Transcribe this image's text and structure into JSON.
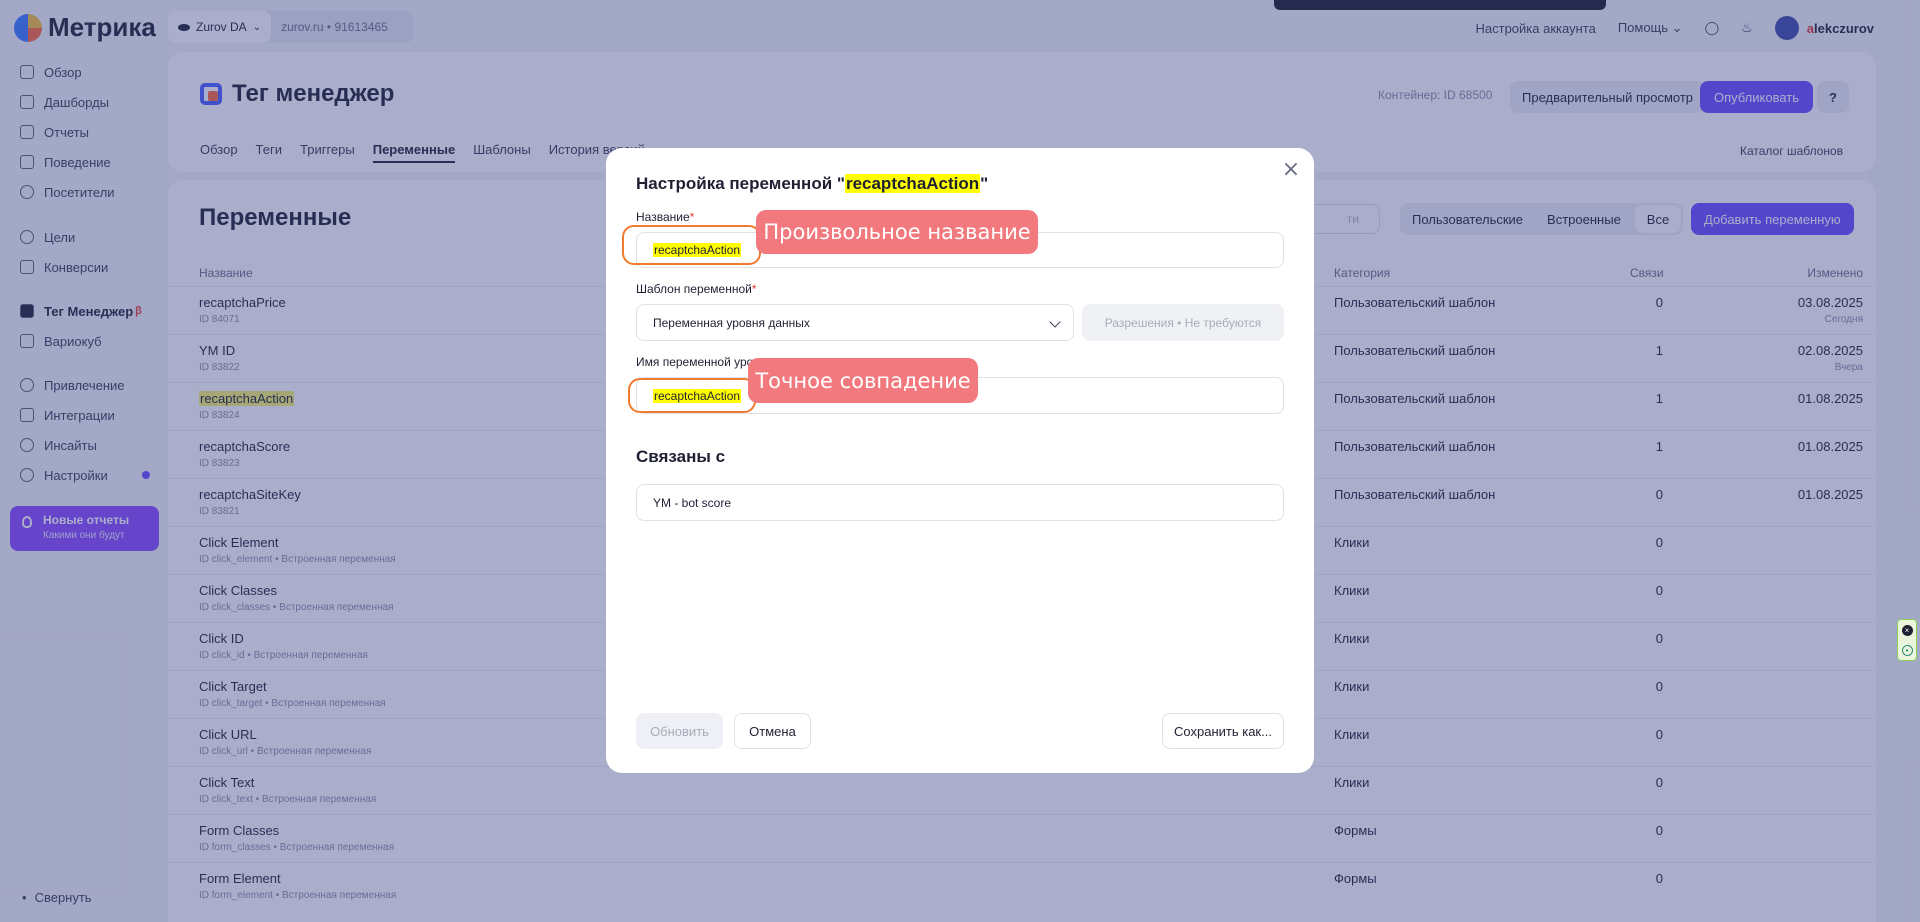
{
  "sidebar": {
    "logo": "Метрика",
    "items": [
      {
        "label": "Обзор",
        "icon": "grid-icon"
      },
      {
        "label": "Дашборды",
        "icon": "dashboard-icon"
      },
      {
        "label": "Отчеты",
        "icon": "bar-chart-icon"
      },
      {
        "label": "Поведение",
        "icon": "play-icon"
      },
      {
        "label": "Посетители",
        "icon": "user-icon"
      },
      {
        "label": "Цели",
        "icon": "target-icon"
      },
      {
        "label": "Конверсии",
        "icon": "percent-icon"
      },
      {
        "label": "Тег Менеджер",
        "icon": "tag-manager-icon",
        "badge": "β",
        "active": true
      },
      {
        "label": "Вариокуб",
        "icon": "cube-icon"
      },
      {
        "label": "Привлечение",
        "icon": "fire-icon"
      },
      {
        "label": "Интеграции",
        "icon": "plug-icon"
      },
      {
        "label": "Инсайты",
        "icon": "sparkle-icon"
      },
      {
        "label": "Настройки",
        "icon": "gear-icon"
      }
    ],
    "promo": {
      "title": "Новые отчеты",
      "subtitle": "Какими они будут"
    },
    "collapse": "Свернуть"
  },
  "topbar": {
    "counter_name": "Zurov DA",
    "counter_site": "zurov.ru",
    "counter_sep": "•",
    "counter_id": "91613465",
    "account_settings": "Настройка аккаунта",
    "help": "Помощь",
    "username_first": "a",
    "username_rest": "lekczurov"
  },
  "header": {
    "title": "Тег менеджер",
    "container_id": "Контейнер: ID 68500",
    "preview": "Предварительный просмотр",
    "publish": "Опубликовать",
    "help_icon": "?",
    "tabs": [
      "Обзор",
      "Теги",
      "Триггеры",
      "Переменные",
      "Шаблоны",
      "История версий"
    ],
    "active_tab": "Переменные",
    "catalog": "Каталог шаблонов"
  },
  "variables": {
    "title": "Переменные",
    "search_placeholder": "ти",
    "filters": [
      "Пользовательские",
      "Встроенные",
      "Все"
    ],
    "selected_filter": "Все",
    "add_button": "Добавить переменную",
    "columns": {
      "name": "Название",
      "category": "Категория",
      "links": "Связи",
      "changed": "Изменено"
    },
    "rows": [
      {
        "name": "recaptchaPrice",
        "id": "ID 84071",
        "category": "Пользовательский шаблон",
        "links": "0",
        "date": "03.08.2025",
        "date_note": "Сегодня"
      },
      {
        "name": "YM ID",
        "id": "ID 83822",
        "category": "Пользовательский шаблон",
        "links": "1",
        "date": "02.08.2025",
        "date_note": "Вчера"
      },
      {
        "name": "recaptchaAction",
        "id": "ID 83824",
        "category": "Пользовательский шаблон",
        "links": "1",
        "date": "01.08.2025",
        "date_note": "",
        "highlight": true
      },
      {
        "name": "recaptchaScore",
        "id": "ID 83823",
        "category": "Пользовательский шаблон",
        "links": "1",
        "date": "01.08.2025",
        "date_note": ""
      },
      {
        "name": "recaptchaSiteKey",
        "id": "ID 83821",
        "category": "Пользовательский шаблон",
        "links": "0",
        "date": "01.08.2025",
        "date_note": ""
      },
      {
        "name": "Click Element",
        "id": "ID click_element • Встроенная переменная",
        "category": "Клики",
        "links": "0",
        "date": "",
        "date_note": ""
      },
      {
        "name": "Click Classes",
        "id": "ID click_classes • Встроенная переменная",
        "category": "Клики",
        "links": "0",
        "date": "",
        "date_note": ""
      },
      {
        "name": "Click ID",
        "id": "ID click_id • Встроенная переменная",
        "category": "Клики",
        "links": "0",
        "date": "",
        "date_note": ""
      },
      {
        "name": "Click Target",
        "id": "ID click_target • Встроенная переменная",
        "category": "Клики",
        "links": "0",
        "date": "",
        "date_note": ""
      },
      {
        "name": "Click URL",
        "id": "ID click_url • Встроенная переменная",
        "category": "Клики",
        "links": "0",
        "date": "",
        "date_note": ""
      },
      {
        "name": "Click Text",
        "id": "ID click_text • Встроенная переменная",
        "category": "Клики",
        "links": "0",
        "date": "",
        "date_note": ""
      },
      {
        "name": "Form Classes",
        "id": "ID form_classes • Встроенная переменная",
        "category": "Формы",
        "links": "0",
        "date": "",
        "date_note": ""
      },
      {
        "name": "Form Element",
        "id": "ID form_element • Встроенная переменная",
        "category": "Формы",
        "links": "0",
        "date": "",
        "date_note": ""
      }
    ]
  },
  "modal": {
    "title_prefix": "Настройка переменной \"",
    "title_var": "recaptchaAction",
    "title_suffix": "\"",
    "name_label": "Название",
    "required_mark": "*",
    "name_value": "recaptchaAction",
    "template_label": "Шаблон переменной",
    "template_value": "Переменная уровня данных",
    "permissions": "Разрешения • Не требуются",
    "var_name_label": "Имя переменной уро",
    "var_name_value": "recaptchaAction",
    "linked_title": "Связаны с",
    "linked_value": "YM - bot score",
    "update": "Обновить",
    "cancel": "Отмена",
    "save_as": "Сохранить как...",
    "close_icon": "close-icon"
  },
  "annotations": {
    "callout_name": "Произвольное название",
    "callout_match": "Точное совпадение",
    "ring_color": "#f07a2e",
    "callout_color": "#f2797d"
  },
  "colors": {
    "accent": "#6b4bff",
    "highlight": "#ffff00",
    "overlay": "#343e82"
  }
}
